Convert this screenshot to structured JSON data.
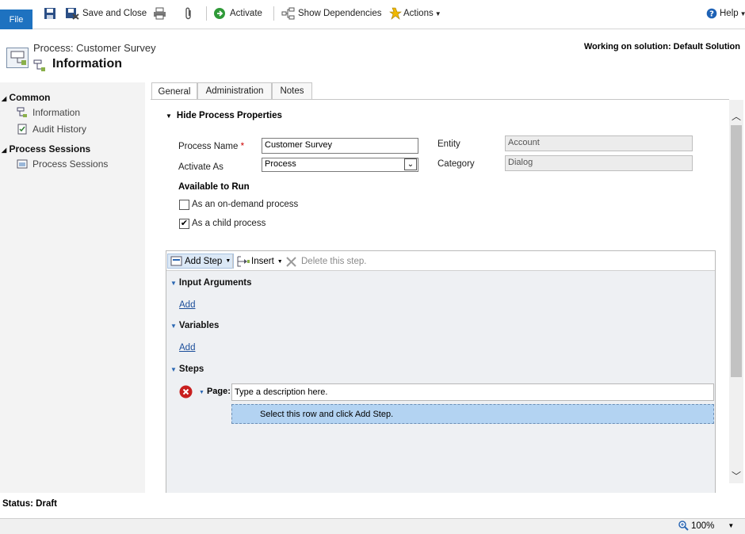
{
  "ribbon": {
    "file_label": "File",
    "save_close_label": "Save and Close",
    "activate_label": "Activate",
    "show_dependencies_label": "Show Dependencies",
    "actions_label": "Actions",
    "help_label": "Help"
  },
  "header": {
    "subtitle": "Process: Customer Survey",
    "title": "Information",
    "solution": "Working on solution: Default Solution"
  },
  "nav": {
    "common_header": "Common",
    "information": "Information",
    "audit_history": "Audit History",
    "process_sessions_header": "Process Sessions",
    "process_sessions": "Process Sessions"
  },
  "tabs": [
    {
      "label": "General"
    },
    {
      "label": "Administration"
    },
    {
      "label": "Notes"
    }
  ],
  "form": {
    "section_title": "Hide Process Properties",
    "process_name_label": "Process Name",
    "required_mark": "*",
    "process_name_value": "Customer Survey",
    "activate_as_label": "Activate As",
    "activate_as_value": "Process",
    "entity_label": "Entity",
    "entity_value": "Account",
    "category_label": "Category",
    "category_value": "Dialog",
    "available_to_run": "Available to Run",
    "on_demand_label": "As an on-demand process",
    "on_demand_checked": false,
    "child_process_label": "As a child process",
    "child_process_checked": true
  },
  "designer": {
    "add_step_label": "Add Step",
    "insert_label": "Insert",
    "delete_label": "Delete this step.",
    "input_arguments": "Input Arguments",
    "variables": "Variables",
    "steps": "Steps",
    "add_link": "Add",
    "page_label": "Page:",
    "page_placeholder": "Type a description here.",
    "select_row_text": "Select this row and click Add Step."
  },
  "status": {
    "text": "Status: Draft",
    "zoom": "100%"
  }
}
